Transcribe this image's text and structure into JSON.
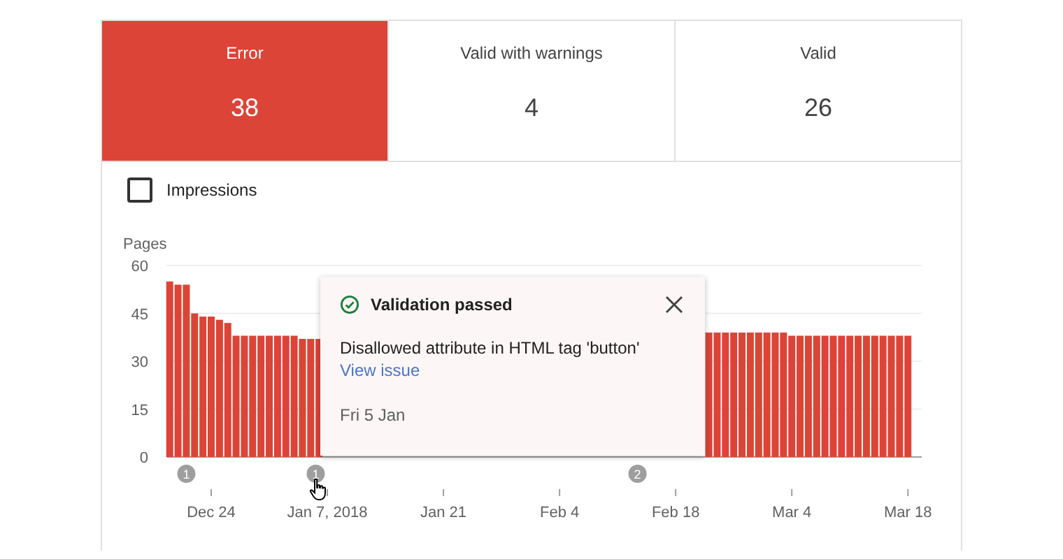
{
  "status_tabs": [
    {
      "label": "Error",
      "count": "38",
      "selected": true
    },
    {
      "label": "Valid with warnings",
      "count": "4",
      "selected": false
    },
    {
      "label": "Valid",
      "count": "26",
      "selected": false
    }
  ],
  "impressions_checkbox": {
    "label": "Impressions",
    "checked": false
  },
  "chart": {
    "chart_data": {
      "type": "bar",
      "ylabel": "Pages",
      "ylim": [
        0,
        60
      ],
      "yticks": [
        0,
        15,
        30,
        45,
        60
      ],
      "grid": true,
      "categories": [
        null,
        null,
        null,
        null,
        null,
        "Dec 24",
        null,
        null,
        null,
        null,
        null,
        null,
        null,
        null,
        null,
        null,
        null,
        null,
        null,
        "Jan 7, 2018",
        null,
        null,
        null,
        null,
        null,
        null,
        null,
        null,
        null,
        null,
        null,
        null,
        null,
        "Jan 21",
        null,
        null,
        null,
        null,
        null,
        null,
        null,
        null,
        null,
        null,
        null,
        null,
        null,
        "Feb 4",
        null,
        null,
        null,
        null,
        null,
        null,
        null,
        null,
        null,
        null,
        null,
        null,
        null,
        "Feb 18",
        null,
        null,
        null,
        null,
        null,
        null,
        null,
        null,
        null,
        null,
        null,
        null,
        null,
        "Mar 4",
        null,
        null,
        null,
        null,
        null,
        null,
        null,
        null,
        null,
        null,
        null,
        null,
        null,
        "Mar 18"
      ],
      "series": [
        {
          "color": "#db4437",
          "values": [
            55,
            54,
            54,
            45,
            44,
            44,
            43,
            42,
            38,
            38,
            38,
            38,
            38,
            38,
            38,
            38,
            37,
            37,
            37,
            null,
            null,
            null,
            null,
            null,
            null,
            null,
            null,
            null,
            null,
            null,
            null,
            null,
            null,
            null,
            null,
            null,
            null,
            null,
            null,
            null,
            null,
            null,
            null,
            null,
            null,
            null,
            null,
            null,
            null,
            null,
            null,
            null,
            null,
            null,
            null,
            null,
            null,
            null,
            null,
            null,
            null,
            null,
            null,
            null,
            null,
            39,
            39,
            39,
            39,
            39,
            39,
            39,
            39,
            39,
            39,
            38,
            38,
            38,
            38,
            38,
            38,
            38,
            38,
            38,
            38,
            38,
            38,
            38,
            38,
            38
          ]
        }
      ],
      "annotations": [
        "1",
        "1",
        "2"
      ]
    },
    "tooltip": {
      "title": "Validation passed",
      "message": "Disallowed attribute in HTML tag 'button'",
      "link": "View issue",
      "date": "Fri 5 Jan"
    }
  }
}
